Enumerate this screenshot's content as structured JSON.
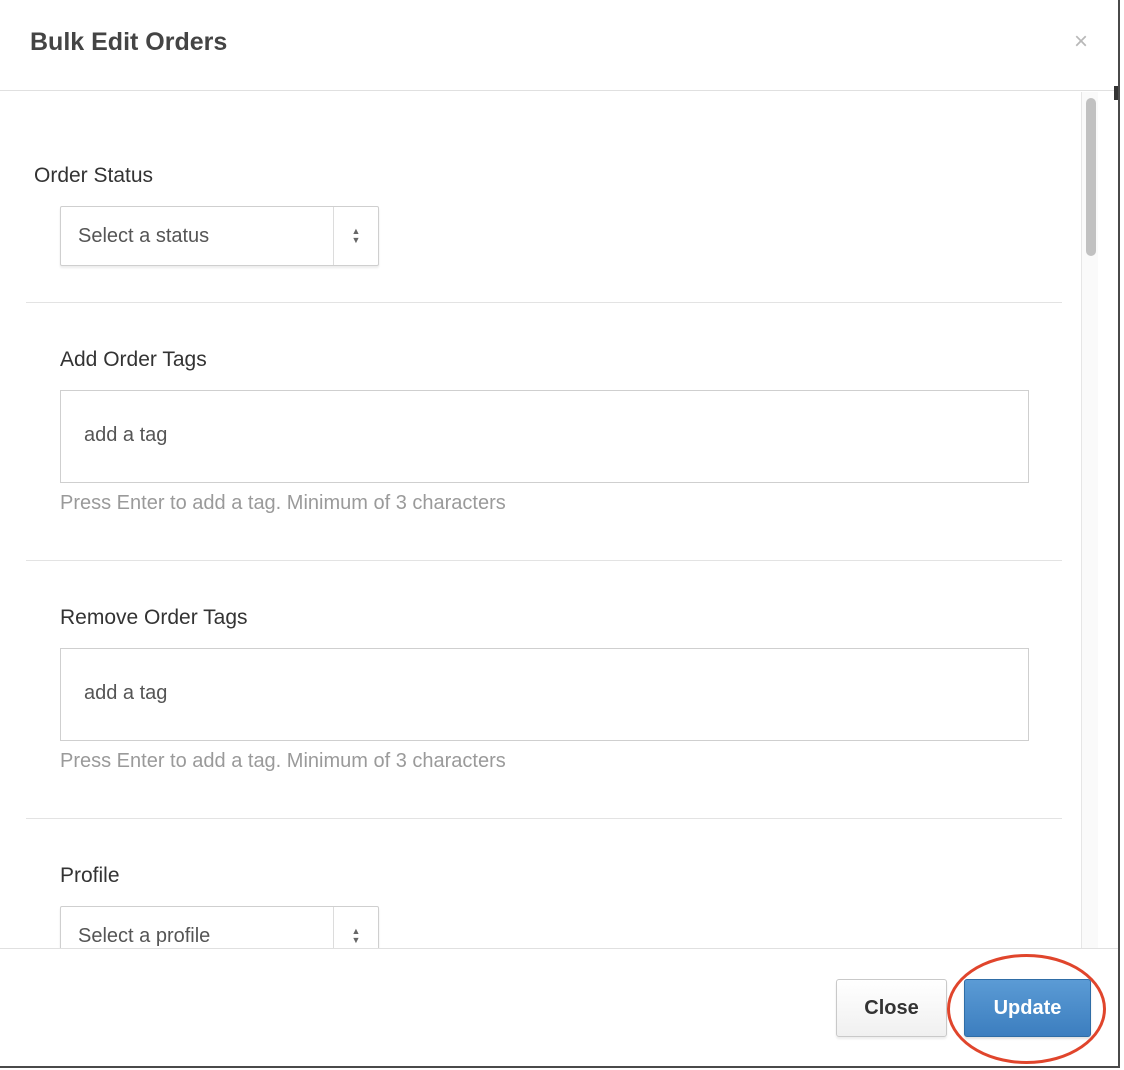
{
  "modal": {
    "title": "Bulk Edit Orders",
    "close_glyph": "×"
  },
  "fields": {
    "order_status": {
      "label": "Order Status",
      "selected": "Select a status"
    },
    "add_tags": {
      "label": "Add Order Tags",
      "placeholder": "add a tag",
      "help": "Press Enter to add a tag. Minimum of 3 characters"
    },
    "remove_tags": {
      "label": "Remove Order Tags",
      "placeholder": "add a tag",
      "help": "Press Enter to add a tag. Minimum of 3 characters"
    },
    "profile": {
      "label": "Profile",
      "selected": "Select a profile"
    }
  },
  "footer": {
    "close_label": "Close",
    "update_label": "Update"
  },
  "icons": {
    "close": "close-icon",
    "select_arrows": "chevron-up-down-icon"
  },
  "colors": {
    "primary_button": "#4a8cca",
    "highlight_ring": "#e0452c",
    "help_text": "#9a9a9a"
  }
}
